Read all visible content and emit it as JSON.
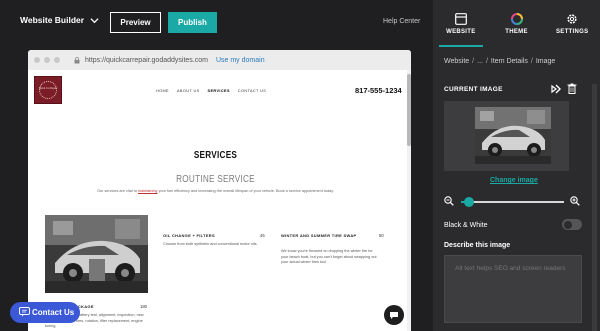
{
  "editor": {
    "brand": "Website Builder",
    "preview_label": "Preview",
    "publish_label": "Publish",
    "help_label": "Help Center"
  },
  "browser": {
    "url": "https://quickcarrepair.godaddysites.com",
    "use_domain": "Use my domain"
  },
  "site": {
    "logo_text": "Quick Car Repair",
    "nav": [
      "HOME",
      "ABOUT US",
      "SERVICES",
      "CONTACT US"
    ],
    "active_nav": "SERVICES",
    "phone": "817-555-1234",
    "section_title": "SERVICES",
    "section_subtitle": "ROUTINE SERVICE",
    "desc_before": "Our services are vital to ",
    "desc_link": "maintaining",
    "desc_after": " your fuel efficiency and increasing the overall lifespan of your vehicle. Book a service appointment today.",
    "items": [
      {
        "title": "ALL IN ONE PACKAGE",
        "price": "180",
        "desc": "All of it: oil change, battery test, alignment, inspection, new fluids, light check, tires, rotation, filter replacement, engine tuning,"
      },
      {
        "title": "OIL CHANGE + FILTERS",
        "price": "45",
        "desc": "Choose from both synthetic and conventional motor oils."
      },
      {
        "title": "WINTER AND SUMMER TIRE SWAP",
        "price": "50",
        "desc": "We know you're focused on dropping the winter tire for your beach boat, but you can't forget about swapping out your actual winter tires too!"
      }
    ]
  },
  "contact_button": "Contact Us",
  "panel": {
    "tabs": [
      {
        "label": "WEBSITE",
        "icon": "website-icon"
      },
      {
        "label": "THEME",
        "icon": "theme-icon"
      },
      {
        "label": "SETTINGS",
        "icon": "settings-icon"
      }
    ],
    "active_tab": "WEBSITE",
    "breadcrumb": [
      "Website",
      "...",
      "Item Details",
      "Image"
    ],
    "current_image_label": "CURRENT IMAGE",
    "change_image_label": "Change image",
    "zoom_level": 0.04,
    "bw_label": "Black & White",
    "bw_enabled": false,
    "describe_label": "Describe this image",
    "alt_placeholder": "Alt text helps SEO and screen readers"
  },
  "colors": {
    "accent": "#1aa9a4",
    "contact": "#3b58d6",
    "panel_bg": "#2b2b2d",
    "editor_bg": "#1f1f21",
    "logo_bg": "#7a1d26"
  }
}
